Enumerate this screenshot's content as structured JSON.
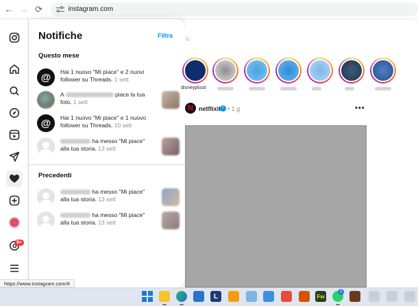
{
  "browser": {
    "back_icon": "arrow-left-icon",
    "forward_icon": "arrow-right-icon",
    "reload_icon": "reload-icon",
    "site_settings_icon": "tune-icon",
    "url": "instagram.com"
  },
  "sidebar_rail": {
    "items": [
      {
        "name": "instagram-logo-icon"
      },
      {
        "name": "home-icon"
      },
      {
        "name": "search-icon"
      },
      {
        "name": "explore-compass-icon"
      },
      {
        "name": "reels-icon"
      },
      {
        "name": "direct-messages-icon"
      },
      {
        "name": "notifications-heart-icon",
        "active": true
      },
      {
        "name": "create-plus-icon"
      },
      {
        "name": "profile-avatar"
      },
      {
        "name": "threads-icon",
        "badge": "9+"
      },
      {
        "name": "more-menu-icon"
      }
    ]
  },
  "notifications": {
    "title": "Notifiche",
    "filter_label": "Filtra",
    "this_month": {
      "heading": "Questo mese",
      "items": [
        {
          "avatar": "threads",
          "text": "Hai 1 nuovo \"Mi piace\" e 2 nuovi follower su Threads.",
          "time": "1 sett",
          "thumb": false
        },
        {
          "avatar": "photo",
          "prefix": "A",
          "text": "piace la tua foto.",
          "time": "1 sett",
          "thumb": true
        },
        {
          "avatar": "threads",
          "text": "Hai 1 nuovo \"Mi piace\" e 1 nuovo follower su Threads.",
          "time": "10 sett",
          "thumb": false
        },
        {
          "avatar": "person",
          "text": "ha messo \"Mi piace\" alla tua storia.",
          "time": "13 sett",
          "thumb": true
        }
      ]
    },
    "earlier": {
      "heading": "Precedenti",
      "items": [
        {
          "avatar": "person",
          "text": "ha messo \"Mi piace\" alla tua storia.",
          "time": "13 sett",
          "thumb": true
        },
        {
          "avatar": "person",
          "text": "ha messo \"Mi piace\" alla tua storia.",
          "time": "13 sett",
          "thumb": true
        }
      ]
    }
  },
  "feed": {
    "tab_fragment": "iti",
    "stories": [
      {
        "label": "disneyplusit"
      },
      {
        "label": ""
      },
      {
        "label": ""
      },
      {
        "label": ""
      },
      {
        "label": ""
      },
      {
        "label": ""
      },
      {
        "label": ""
      }
    ],
    "post": {
      "author": "netflixit",
      "verified_icon": "verified-badge-icon",
      "time": "1 g",
      "more_icon": "more-horizontal-icon"
    }
  },
  "status_bar": {
    "url": "https://www.instagram.com/#"
  },
  "taskbar": {
    "apps": [
      "windows-start-icon",
      "file-explorer-icon",
      "edge-icon",
      "store-icon",
      "l-app-icon",
      "app-icon",
      "app-icon",
      "notepad-icon",
      "app-icon",
      "app-icon",
      "fireworks-icon",
      "whatsapp-icon",
      "app-icon"
    ],
    "whatsapp_badge": "2"
  }
}
